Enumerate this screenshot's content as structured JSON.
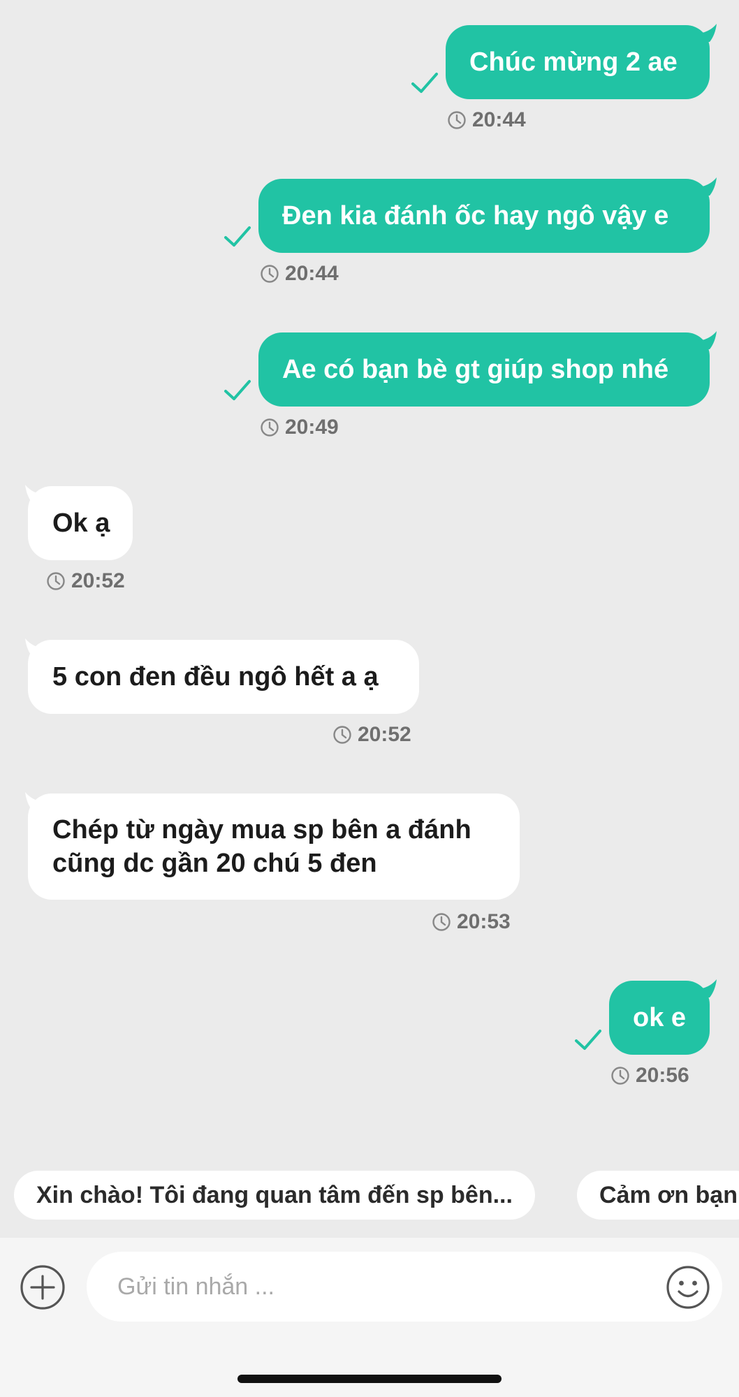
{
  "theme": {
    "outgoing_bubble": "#21c3a4",
    "incoming_bubble": "#ffffff",
    "background": "#ebebeb"
  },
  "messages": [
    {
      "direction": "outgoing",
      "text": "Chúc mừng 2 ae",
      "time": "20:44",
      "status_icon": "check-icon"
    },
    {
      "direction": "outgoing",
      "text": "Đen kia đánh ốc hay ngô vậy e",
      "time": "20:44",
      "status_icon": "check-icon"
    },
    {
      "direction": "outgoing",
      "text": "Ae có bạn bè gt giúp shop nhé",
      "time": "20:49",
      "status_icon": "check-icon"
    },
    {
      "direction": "incoming",
      "text": "Ok ạ",
      "time": "20:52"
    },
    {
      "direction": "incoming",
      "text": "5 con đen đều ngô hết a ạ",
      "time": "20:52"
    },
    {
      "direction": "incoming",
      "text": "Chép từ ngày mua sp bên a đánh cũng dc gần 20 chú 5 đen",
      "time": "20:53"
    },
    {
      "direction": "outgoing",
      "text": "ok e",
      "time": "20:56",
      "status_icon": "check-icon"
    }
  ],
  "quick_replies": [
    "Xin chào! Tôi đang quan tâm đến sp bên...",
    "Cảm ơn bạn"
  ],
  "composer": {
    "placeholder": "Gửi tin nhắn ...",
    "left_icon": "plus-icon",
    "right_icon": "emoji-icon"
  }
}
